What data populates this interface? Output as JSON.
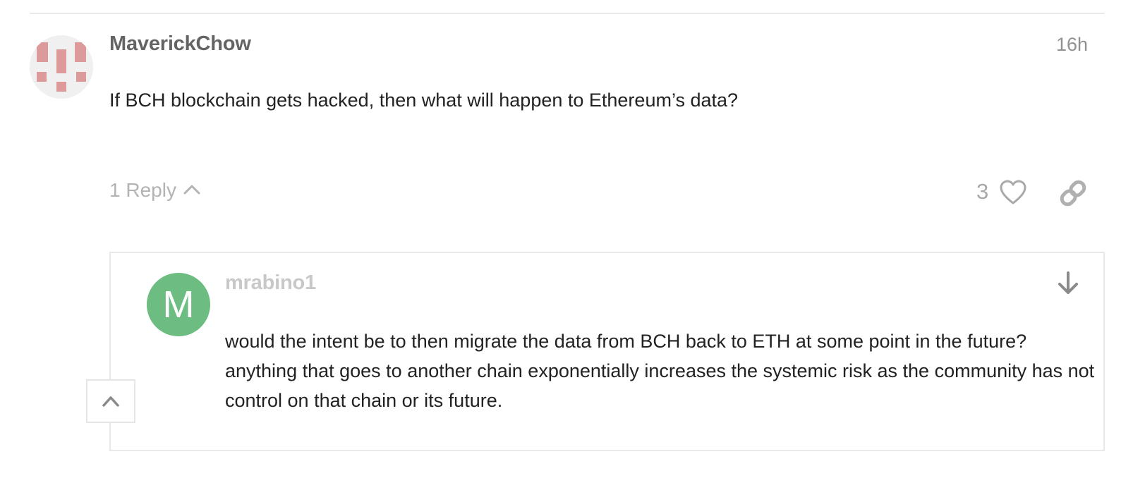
{
  "post": {
    "username": "MaverickChow",
    "time": "16h",
    "body": "If BCH blockchain gets hacked, then what will happen to Ethereum’s data?",
    "avatar_icon": "pixel-avatar-icon",
    "replies_label": "1 Reply",
    "likes": "3",
    "colors": {
      "avatar_background": "#f0f0f0",
      "avatar_pixels": "#dd9a9a",
      "username": "#646464"
    }
  },
  "reply": {
    "username": "mrabino1",
    "avatar_letter": "M",
    "body": "would the intent be to then migrate the data from BCH back to ETH at some point in the future? anything that goes to another chain exponentially increases the systemic risk as the community has not control on that chain or its future.",
    "colors": {
      "avatar_background": "#6dbd83",
      "username": "#c8c8c8"
    }
  },
  "icons": {
    "replies_toggle": "chevron-up-icon",
    "like": "heart-icon",
    "share": "link-icon",
    "jump_to_reply": "arrow-down-icon",
    "collapse": "chevron-up-icon"
  }
}
